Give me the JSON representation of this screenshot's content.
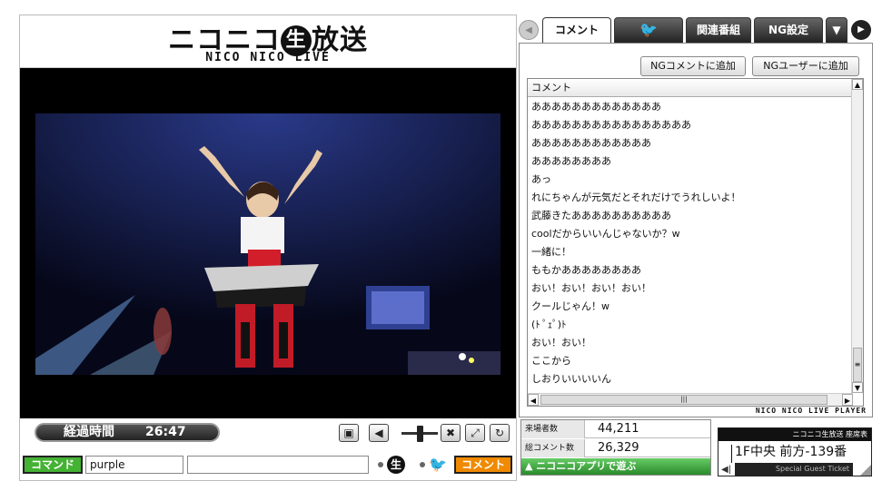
{
  "logo": {
    "title_left": "ニコニコ",
    "title_mark": "生",
    "title_right": "放送",
    "subtitle": "NICO NICO LIVE"
  },
  "controls": {
    "elapsed_label": "経過時間",
    "elapsed_time": "26:47",
    "command_button": "コマンド",
    "command_value": "purple",
    "comment_value": "",
    "nama_mark": "生",
    "comment_button": "コメント"
  },
  "tabs": [
    {
      "label": "コメント"
    },
    {
      "label": ""
    },
    {
      "label": "関連番組"
    },
    {
      "label": "NG設定"
    }
  ],
  "comment_panel": {
    "ng_comment_button": "NGコメントに追加",
    "ng_user_button": "NGユーザーに追加",
    "column_header": "コメント",
    "comments": [
      "あああああああああああああ",
      "ああああああああああああああああ",
      "ああああああああああああ",
      "ああああああああ",
      "あっ",
      "れにちゃんが元気だとそれだけでうれしいよ！",
      "武藤きたああああああああああ",
      "coolだからいいんじゃないか？w",
      "一緒に！",
      "ももかああああああああ",
      "おい！おい！おい！おい！",
      "クールじゃん！w",
      "(ﾄ ﾟｪﾟ)ﾄ",
      "おい！おい！",
      "ここから",
      "しおりいいいいん"
    ],
    "player_brand": "NICO NICO LIVE PLAYER"
  },
  "stats": {
    "visitors_label": "来場者数",
    "visitors_value": "44,211",
    "comments_label": "総コメント数",
    "comments_value": "26,329",
    "app_link": "▲ ニコニコアプリで遊ぶ"
  },
  "ticket": {
    "header": "ニコニコ生放送 座席表",
    "seat": "1F中央 前方-139番",
    "guest": "Special Guest Ticket"
  },
  "colors": {
    "accent_green": "#44b233",
    "accent_orange": "#f08a00",
    "twitter_blue": "#1a9bd6"
  }
}
